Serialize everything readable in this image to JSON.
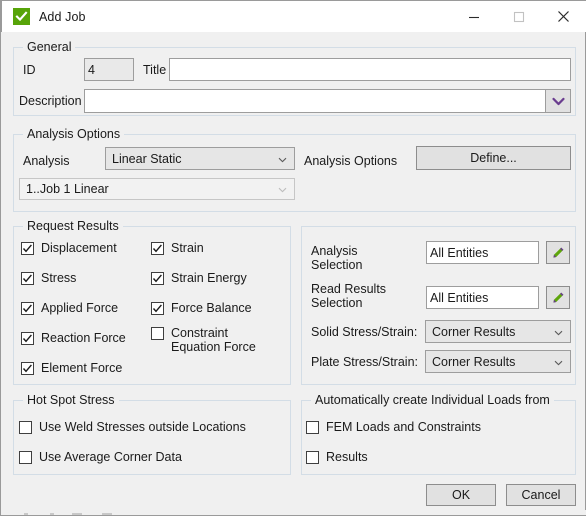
{
  "window": {
    "title": "Add Job",
    "icon": "check-icon",
    "controls": {
      "minimize": "minimize-icon",
      "maximize": "maximize-icon",
      "close": "close-icon"
    }
  },
  "general": {
    "legend": "General",
    "id_label": "ID",
    "id_value": "4",
    "title_label": "Title",
    "title_value": "",
    "description_label": "Description",
    "description_value": "",
    "description_arrow": "chevron-down-icon"
  },
  "analysis_options": {
    "legend": "Analysis Options",
    "analysis_label": "Analysis",
    "analysis_value": "Linear Static",
    "options_label": "Analysis Options",
    "define_button": "Define...",
    "job_value": "1..Job 1 Linear"
  },
  "request_results": {
    "legend": "Request Results",
    "left_column": [
      {
        "label": "Displacement",
        "checked": true
      },
      {
        "label": "Stress",
        "checked": true
      },
      {
        "label": "Applied Force",
        "checked": true
      },
      {
        "label": "Reaction Force",
        "checked": true
      },
      {
        "label": "Element Force",
        "checked": true
      }
    ],
    "right_column": [
      {
        "label": "Strain",
        "checked": true
      },
      {
        "label": "Strain Energy",
        "checked": true
      },
      {
        "label": "Force Balance",
        "checked": true
      },
      {
        "label": "Constraint Equation Force",
        "checked": false
      }
    ]
  },
  "selection_panel": {
    "analysis_selection_label": "Analysis Selection",
    "analysis_selection_value": "All Entities",
    "analysis_selection_edit": "pencil-icon",
    "read_results_label": "Read Results Selection",
    "read_results_value": "All Entities",
    "read_results_edit": "pencil-icon",
    "solid_label": "Solid Stress/Strain:",
    "solid_value": "Corner Results",
    "plate_label": "Plate Stress/Strain:",
    "plate_value": "Corner Results"
  },
  "hot_spot_stress": {
    "legend": "Hot Spot Stress",
    "items": [
      {
        "label": "Use Weld Stresses outside Locations",
        "checked": false
      },
      {
        "label": "Use Average Corner Data",
        "checked": false
      }
    ]
  },
  "individual_loads": {
    "legend": "Automatically create Individual Loads from",
    "items": [
      {
        "label": "FEM Loads and Constraints",
        "checked": false
      },
      {
        "label": "Results",
        "checked": false
      }
    ]
  },
  "footer": {
    "ok_label": "OK",
    "cancel_label": "Cancel"
  },
  "colors": {
    "accent_green": "#57a409",
    "chevron_purple": "#6a3d8f",
    "group_border": "#d3dde6",
    "dialog_background": "#f0f0f0"
  }
}
